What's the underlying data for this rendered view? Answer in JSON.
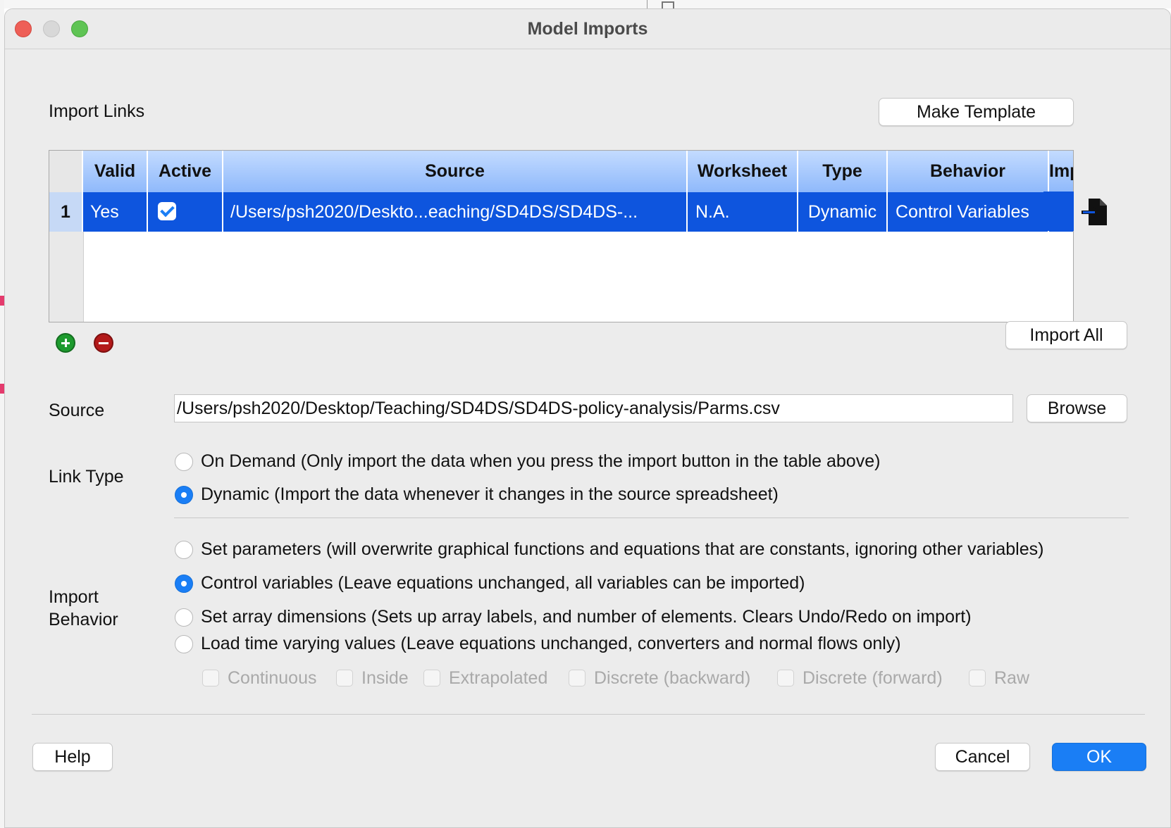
{
  "window": {
    "title": "Model Imports"
  },
  "import_links": {
    "label": "Import Links",
    "make_template_label": "Make Template",
    "columns": [
      "Valid",
      "Active",
      "Source",
      "Worksheet",
      "Type",
      "Behavior",
      "Import"
    ],
    "rows": [
      {
        "num": "1",
        "valid": "Yes",
        "active": true,
        "source": "/Users/psh2020/Deskto...eaching/SD4DS/SD4DS-...",
        "worksheet": "N.A.",
        "type": "Dynamic",
        "behavior": "Control Variables",
        "import_icon": "import-file-icon"
      }
    ],
    "add_icon": "plus-circle-icon",
    "remove_icon": "minus-circle-icon",
    "import_all_label": "Import All"
  },
  "source": {
    "label": "Source",
    "value": "/Users/psh2020/Desktop/Teaching/SD4DS/SD4DS-policy-analysis/Parms.csv",
    "browse_label": "Browse"
  },
  "link_type": {
    "label": "Link Type",
    "options": [
      {
        "text": "On Demand (Only import the data when you press the import button in the table above)",
        "selected": false
      },
      {
        "text": "Dynamic (Import the data whenever it changes in the source spreadsheet)",
        "selected": true
      }
    ]
  },
  "import_behavior": {
    "label_line1": "Import",
    "label_line2": "Behavior",
    "options": [
      {
        "text": "Set parameters (will overwrite graphical functions and equations that are constants, ignoring other variables)",
        "selected": false
      },
      {
        "text": "Control variables (Leave equations unchanged, all variables can be imported)",
        "selected": true
      },
      {
        "text": "Set array dimensions (Sets up array labels, and number of elements. Clears Undo/Redo on import)",
        "selected": false
      },
      {
        "text": "Load time varying values (Leave equations unchanged, converters and normal flows only)",
        "selected": false
      }
    ],
    "time_options": [
      "Continuous",
      "Inside",
      "Extrapolated",
      "Discrete (backward)",
      "Discrete (forward)",
      "Raw"
    ]
  },
  "footer": {
    "help_label": "Help",
    "cancel_label": "Cancel",
    "ok_label": "OK"
  },
  "colors": {
    "accent": "#1a7ef5",
    "selection": "#0e55de",
    "header": "#a9c9fd"
  }
}
